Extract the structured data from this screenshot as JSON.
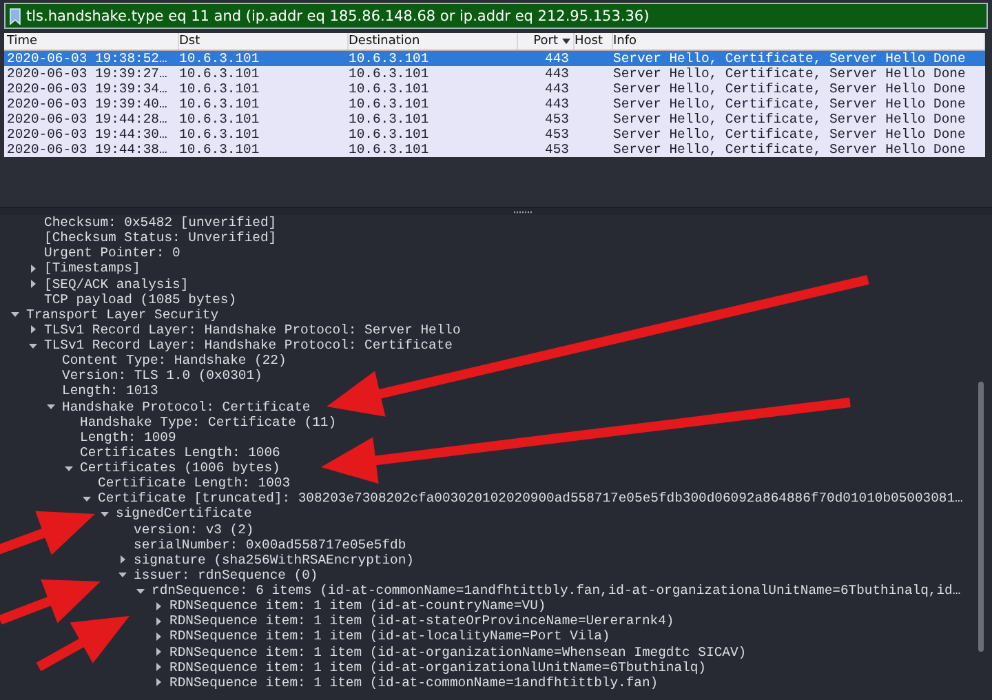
{
  "filter": {
    "value": "tls.handshake.type eq 11 and (ip.addr eq 185.86.148.68 or ip.addr eq 212.95.153.36)"
  },
  "columns": [
    {
      "label": "Time",
      "sorted": false
    },
    {
      "label": "Dst",
      "sorted": false
    },
    {
      "label": "Destination",
      "sorted": false
    },
    {
      "label": "Port",
      "sorted": true
    },
    {
      "label": "Host",
      "sorted": false
    },
    {
      "label": "Info",
      "sorted": false
    }
  ],
  "packets": [
    {
      "selected": true,
      "cells": [
        "2020-06-03 19:38:52…",
        "10.6.3.101",
        "10.6.3.101",
        "443",
        "",
        "Server Hello, Certificate, Server Hello Done"
      ]
    },
    {
      "selected": false,
      "cells": [
        "2020-06-03 19:39:27…",
        "10.6.3.101",
        "10.6.3.101",
        "443",
        "",
        "Server Hello, Certificate, Server Hello Done"
      ]
    },
    {
      "selected": false,
      "cells": [
        "2020-06-03 19:39:34…",
        "10.6.3.101",
        "10.6.3.101",
        "443",
        "",
        "Server Hello, Certificate, Server Hello Done"
      ]
    },
    {
      "selected": false,
      "cells": [
        "2020-06-03 19:39:40…",
        "10.6.3.101",
        "10.6.3.101",
        "443",
        "",
        "Server Hello, Certificate, Server Hello Done"
      ]
    },
    {
      "selected": false,
      "cells": [
        "2020-06-03 19:44:28…",
        "10.6.3.101",
        "10.6.3.101",
        "453",
        "",
        "Server Hello, Certificate, Server Hello Done"
      ]
    },
    {
      "selected": false,
      "cells": [
        "2020-06-03 19:44:30…",
        "10.6.3.101",
        "10.6.3.101",
        "453",
        "",
        "Server Hello, Certificate, Server Hello Done"
      ]
    },
    {
      "selected": false,
      "cells": [
        "2020-06-03 19:44:38…",
        "10.6.3.101",
        "10.6.3.101",
        "453",
        "",
        "Server Hello, Certificate, Server Hello Done"
      ]
    }
  ],
  "tree": [
    {
      "children": [
        {
          "label": "Checksum: 0x5482 [unverified]"
        },
        {
          "label": "[Checksum Status: Unverified]"
        },
        {
          "label": "Urgent Pointer: 0"
        },
        {
          "label": "[Timestamps]",
          "expanded": false
        },
        {
          "label": "[SEQ/ACK analysis]",
          "expanded": false
        },
        {
          "label": "TCP payload (1085 bytes)"
        }
      ]
    },
    {
      "label": "Transport Layer Security",
      "expanded": true,
      "children": [
        {
          "label": "TLSv1 Record Layer: Handshake Protocol: Server Hello",
          "expanded": false
        },
        {
          "label": "TLSv1 Record Layer: Handshake Protocol: Certificate",
          "expanded": true,
          "children": [
            {
              "label": "Content Type: Handshake (22)"
            },
            {
              "label": "Version: TLS 1.0 (0x0301)"
            },
            {
              "label": "Length: 1013"
            },
            {
              "label": "Handshake Protocol: Certificate",
              "expanded": true,
              "children": [
                {
                  "label": "Handshake Type: Certificate (11)"
                },
                {
                  "label": "Length: 1009"
                },
                {
                  "label": "Certificates Length: 1006"
                },
                {
                  "label": "Certificates (1006 bytes)",
                  "expanded": true,
                  "children": [
                    {
                      "label": "Certificate Length: 1003"
                    },
                    {
                      "label": "Certificate [truncated]: 308203e7308202cfa003020102020900ad558717e05e5fdb300d06092a864886f70d01010b05003081…",
                      "expanded": true,
                      "children": [
                        {
                          "label": "signedCertificate",
                          "expanded": true,
                          "children": [
                            {
                              "label": "version: v3 (2)"
                            },
                            {
                              "label": "serialNumber: 0x00ad558717e05e5fdb"
                            },
                            {
                              "label": "signature (sha256WithRSAEncryption)",
                              "expanded": false
                            },
                            {
                              "label": "issuer: rdnSequence (0)",
                              "expanded": true,
                              "children": [
                                {
                                  "label": "rdnSequence: 6 items (id-at-commonName=1andfhtittbly.fan,id-at-organizationalUnitName=6Tbuthinalq,id…",
                                  "expanded": true,
                                  "children": [
                                    {
                                      "label": "RDNSequence item: 1 item (id-at-countryName=VU)",
                                      "expanded": false
                                    },
                                    {
                                      "label": "RDNSequence item: 1 item (id-at-stateOrProvinceName=Uererarnk4)",
                                      "expanded": false
                                    },
                                    {
                                      "label": "RDNSequence item: 1 item (id-at-localityName=Port Vila)",
                                      "expanded": false
                                    },
                                    {
                                      "label": "RDNSequence item: 1 item (id-at-organizationName=Whensean Imegdtc SICAV)",
                                      "expanded": false
                                    },
                                    {
                                      "label": "RDNSequence item: 1 item (id-at-organizationalUnitName=6Tbuthinalq)",
                                      "expanded": false
                                    },
                                    {
                                      "label": "RDNSequence item: 1 item (id-at-commonName=1andfhtittbly.fan)",
                                      "expanded": false
                                    }
                                  ]
                                }
                              ]
                            }
                          ]
                        }
                      ]
                    }
                  ]
                }
              ]
            }
          ]
        }
      ]
    }
  ]
}
